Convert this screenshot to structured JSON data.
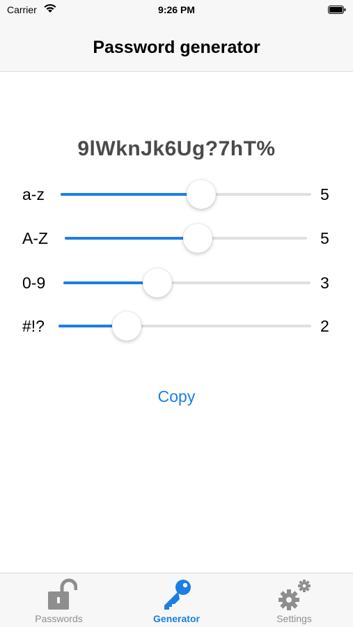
{
  "status_bar": {
    "carrier": "Carrier",
    "time": "9:26 PM"
  },
  "nav": {
    "title": "Password generator"
  },
  "password": "9lWknJk6Ug?7hT%",
  "sliders": [
    {
      "label": "a-z",
      "value": "5",
      "fraction": 0.56
    },
    {
      "label": "A-Z",
      "value": "5",
      "fraction": 0.55
    },
    {
      "label": "0-9",
      "value": "3",
      "fraction": 0.38
    },
    {
      "label": "#!?",
      "value": "2",
      "fraction": 0.27
    }
  ],
  "copy_label": "Copy",
  "tabs": [
    {
      "label": "Passwords",
      "icon": "unlocked-padlock-icon",
      "active": false
    },
    {
      "label": "Generator",
      "icon": "key-icon",
      "active": true
    },
    {
      "label": "Settings",
      "icon": "gears-icon",
      "active": false
    }
  ],
  "colors": {
    "accent": "#1a7ee6",
    "inactive": "#8e8e8e",
    "track": "#e0e0e0"
  }
}
